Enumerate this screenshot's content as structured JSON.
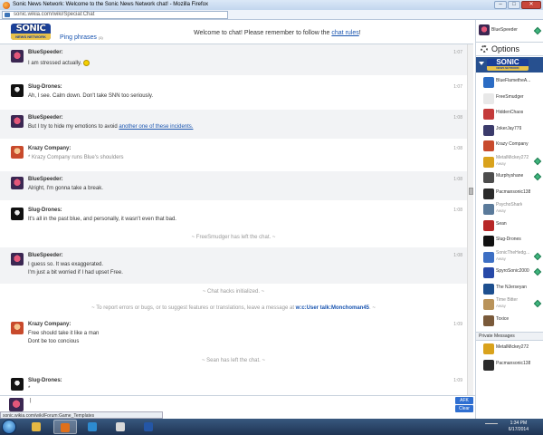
{
  "window": {
    "title": "Sonic News Network: Welcome to the Sonic News Network chat! - Mozilla Firefox",
    "buttons": [
      "–",
      "□",
      "✕"
    ]
  },
  "address": {
    "url": "sonic.wikia.com/wiki/Special:Chat"
  },
  "header": {
    "logo_top": "SONIC",
    "logo_bottom": "NEWS NETWORK",
    "ping_label": "Ping phrases",
    "ping_count": "(1)",
    "welcome_prefix": "Welcome to chat! Please remember to follow the ",
    "welcome_link": "chat rules",
    "welcome_suffix": "!"
  },
  "messages": [
    {
      "user": "BlueSpeeder:",
      "avatar": "bluespeeder",
      "time": "1:07",
      "lines": [
        "I am stressed actually."
      ],
      "emote": true
    },
    {
      "user": "Slug-Drones:",
      "avatar": "slug",
      "time": "1:07",
      "lines": [
        "Ah, I see. Calm down. Don't take SNN too seriously."
      ]
    },
    {
      "user": "BlueSpeeder:",
      "avatar": "bluespeeder",
      "time": "1:08",
      "lines": [
        "But I try to hide my emotions to avoid "
      ],
      "link": "another one of these incidents."
    },
    {
      "user": "Krazy Company:",
      "avatar": "krazy",
      "time": "1:08",
      "lines": [
        "* Krazy Company runs Blue's shoulders"
      ],
      "action": true
    },
    {
      "user": "BlueSpeeder:",
      "avatar": "bluespeeder",
      "time": "1:08",
      "lines": [
        "Alright, I'm gonna take a break."
      ]
    },
    {
      "user": "Slug-Drones:",
      "avatar": "slug",
      "time": "1:08",
      "lines": [
        "It's all in the past blue, and personally, it wasn't even that bad."
      ]
    },
    {
      "user": "BlueSpeeder:",
      "avatar": "bluespeeder",
      "time": "1:08",
      "lines": [
        "I guess so. It was exaggerated.",
        "I'm just a bit worried if I had upset Free."
      ]
    },
    {
      "user": "Krazy Company:",
      "avatar": "krazy",
      "time": "1:09",
      "lines": [
        "Free should take it like a man",
        "Dont be too concious"
      ]
    },
    {
      "user": "Slug-Drones:",
      "avatar": "slug",
      "time": "1:09",
      "lines": [
        "*"
      ]
    }
  ],
  "notices": {
    "left_free": "~ FreeSmudger has left the chat. ~",
    "hacks": "~ Chat hacks initialized. ~",
    "report_prefix": "~ To report errors or bugs, or to suggest features or translations, leave a message at ",
    "report_link": "w:c:User talk:Monchoman45",
    "report_suffix": ". ~",
    "left_sean": "~ Sean has left the chat. ~"
  },
  "input": {
    "value": "|",
    "afk_label": "AFK",
    "clear_label": "Clear"
  },
  "statusbar": {
    "text": "sonic.wikia.com/wiki/Forum:Game_Templates"
  },
  "sidebar": {
    "me": "BlueSpeeder",
    "options_label": "Options",
    "wiki_logo_top": "SONIC",
    "wiki_logo_bottom": "NEWS NETWORK",
    "users": [
      {
        "name": "BlueFlametheA...",
        "status": "",
        "mod": false,
        "color": "#2b6cc4"
      },
      {
        "name": "FreeSmudger",
        "status": "",
        "mod": false,
        "color": "#e8e8e8"
      },
      {
        "name": "HiddenChaos",
        "status": "",
        "mod": false,
        "color": "#c43a3a"
      },
      {
        "name": "JokerJay779",
        "status": "",
        "mod": false,
        "color": "#3b3b6b"
      },
      {
        "name": "Krazy Company",
        "status": "",
        "mod": false,
        "color": "#c84a2c"
      },
      {
        "name": "MetalMickey272",
        "status": "Away",
        "mod": true,
        "color": "#d9a21c"
      },
      {
        "name": "Murphyshane",
        "status": "",
        "mod": true,
        "color": "#4c4c4c"
      },
      {
        "name": "Pacmansonic138",
        "status": "",
        "mod": false,
        "color": "#2a2a2a"
      },
      {
        "name": "PsychoShark",
        "status": "Away",
        "mod": false,
        "color": "#5a7a9a"
      },
      {
        "name": "Sean",
        "status": "",
        "mod": false,
        "color": "#b72727"
      },
      {
        "name": "Slug-Drones",
        "status": "",
        "mod": false,
        "color": "#111111"
      },
      {
        "name": "SonicTheHedg...",
        "status": "Away",
        "mod": true,
        "color": "#3d6fc4"
      },
      {
        "name": "SpyroSonic2000",
        "status": "",
        "mod": true,
        "color": "#2749a8"
      },
      {
        "name": "The NJerseyan",
        "status": "",
        "mod": false,
        "color": "#1d4f8f"
      },
      {
        "name": "Time Bitter",
        "status": "Away",
        "mod": true,
        "color": "#b9935a"
      },
      {
        "name": "Toxice",
        "status": "",
        "mod": false,
        "color": "#7a5a3a"
      }
    ],
    "pm_header": "Private Messages",
    "pms": [
      {
        "name": "MetalMickey272",
        "color": "#d9a21c"
      },
      {
        "name": "Pacmansonic138",
        "color": "#2a2a2a"
      }
    ]
  },
  "taskbar": {
    "time": "1:34 PM",
    "date": "6/17/2014",
    "apps": [
      {
        "name": "explorer-icon",
        "color": "#e5b843"
      },
      {
        "name": "firefox-icon",
        "color": "#e0701a"
      },
      {
        "name": "media-icon",
        "color": "#2d8bd0"
      },
      {
        "name": "paint-icon",
        "color": "#d9d9d9"
      },
      {
        "name": "word-icon",
        "color": "#2456a6"
      }
    ]
  }
}
